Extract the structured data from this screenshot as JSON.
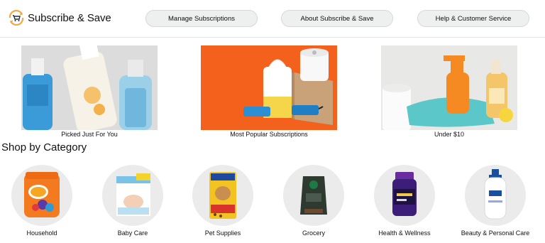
{
  "header": {
    "logo_text": "Subscribe & Save",
    "logo_icon": "cart-refresh-icon",
    "nav": [
      {
        "label": "Manage Subscriptions"
      },
      {
        "label": "About Subscribe & Save"
      },
      {
        "label": "Help & Customer Service"
      }
    ]
  },
  "hero": [
    {
      "caption": "Picked Just For You",
      "image": "cleaning-bottles-image"
    },
    {
      "caption": "Most Popular Subscriptions",
      "image": "wipes-and-paper-towels-image"
    },
    {
      "caption": "Under $10",
      "image": "cleaning-supplies-image"
    }
  ],
  "section_title": "Shop by Category",
  "categories": [
    {
      "label": "Household",
      "image": "detergent-pods-image"
    },
    {
      "label": "Baby Care",
      "image": "diapers-box-image"
    },
    {
      "label": "Pet Supplies",
      "image": "dog-food-bag-image"
    },
    {
      "label": "Grocery",
      "image": "coffee-bag-image"
    },
    {
      "label": "Health & Wellness",
      "image": "supplement-bottle-image"
    },
    {
      "label": "Beauty & Personal Care",
      "image": "body-wash-bottle-image"
    }
  ],
  "colors": {
    "accent": "#f3a847",
    "brand_blue": "#146eb4",
    "orange_hero": "#f4611d"
  }
}
